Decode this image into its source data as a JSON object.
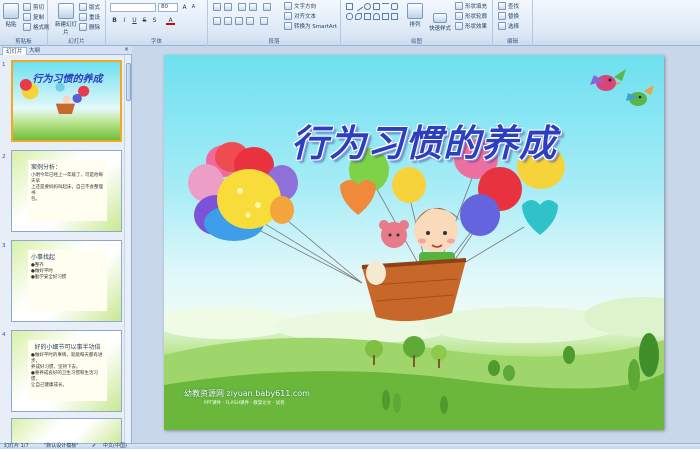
{
  "ribbon": {
    "clipboard": {
      "label": "剪贴板",
      "paste": "粘贴",
      "cut": "剪切",
      "copy": "复制",
      "format_painter": "格式刷"
    },
    "slides": {
      "label": "幻灯片",
      "new_slide": "新建幻灯片",
      "layout": "版式",
      "reset": "重设",
      "delete": "删除"
    },
    "font": {
      "label": "字体",
      "font_name": "",
      "font_size": "80"
    },
    "paragraph": {
      "label": "段落",
      "text_direction": "文字方向",
      "align_text": "对齐文本",
      "smartart": "转换为 SmartArt"
    },
    "drawing": {
      "label": "绘图",
      "arrange": "排列",
      "quick_styles": "快速样式",
      "fill": "形状填充",
      "outline": "形状轮廓",
      "effects": "形状效果"
    },
    "editing": {
      "label": "编辑",
      "find": "查找",
      "replace": "替换",
      "select": "选择"
    }
  },
  "pane": {
    "tabs": [
      "幻灯片",
      "大纲"
    ],
    "slides": [
      {
        "num": "1",
        "title": "行为习惯的养成"
      },
      {
        "num": "2",
        "title": "案例分析：",
        "lines": [
          "小明今年已经上一年级了，可是他每天早",
          "上还是要妈妈叫起床，自己不会整理书",
          "包。"
        ]
      },
      {
        "num": "3",
        "title": "小事找起",
        "lines": [
          "●整齐",
          "●做好平时",
          "●勤学安全好习惯"
        ]
      },
      {
        "num": "4",
        "title": "好的小细节可以事半功倍",
        "lines": [
          "●做好平时的事情，就能每天都有进步，",
          "养成好习惯，坚持下去。",
          "●要养成良好的卫生习惯和生活习惯，",
          "让自己健康成长。"
        ]
      }
    ]
  },
  "slide": {
    "title": "行为习惯的养成",
    "watermark": "幼教资源网 ziyuan.baby611.com",
    "watermark_sub": "PPT课件 · FLASH课件 · 教案论文 · 试卷"
  },
  "status": {
    "slide_indicator": "幻灯片 1/7",
    "theme": "\"默认设计模板\"",
    "language": "中文(中国)"
  },
  "colors": {
    "title": "#2b3fc0",
    "selection": "#f5a623",
    "ribbon": "#dde9f6"
  }
}
